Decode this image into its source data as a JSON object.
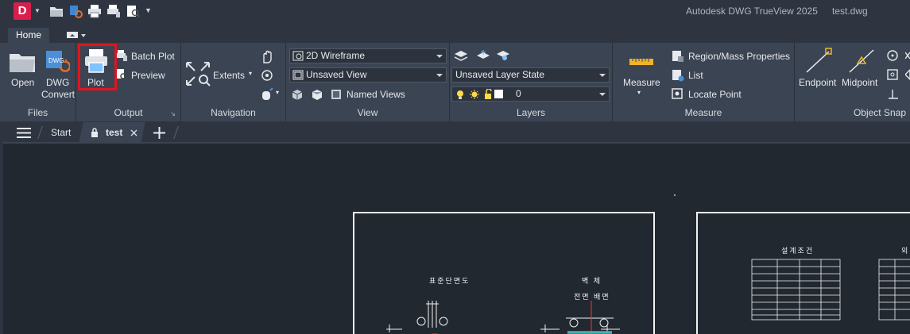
{
  "titlebar": {
    "app_letter": "D",
    "app_title": "Autodesk DWG TrueView 2025",
    "file_name": "test.dwg"
  },
  "tabs": {
    "home": "Home"
  },
  "ribbon": {
    "files": {
      "title": "Files",
      "open": "Open",
      "dwg_convert_line1": "DWG",
      "dwg_convert_line2": "Convert"
    },
    "output": {
      "title": "Output",
      "plot": "Plot",
      "batch_plot": "Batch Plot",
      "preview": "Preview"
    },
    "navigation": {
      "title": "Navigation",
      "extents": "Extents"
    },
    "view": {
      "title": "View",
      "visual_style": "2D Wireframe",
      "saved_view": "Unsaved View",
      "named_views": "Named Views"
    },
    "layers": {
      "title": "Layers",
      "layer_state": "Unsaved Layer State",
      "current_layer": "0"
    },
    "measure": {
      "title": "Measure",
      "measure": "Measure",
      "region_mass": "Region/Mass Properties",
      "list": "List",
      "locate_point": "Locate Point"
    },
    "osnap": {
      "title": "Object Snap",
      "endpoint": "Endpoint",
      "midpoint": "Midpoint"
    }
  },
  "doctabs": {
    "start": "Start",
    "active": "test"
  },
  "drawing": {
    "sheet1_heading": "표준단면도",
    "sheet1_subheading": "벽 체",
    "sheet1_sub2": "전면 배면",
    "sheet2_heading": "설계조건",
    "sheet2_heading_b": "외"
  },
  "colors": {
    "accent_highlight": "#e0141e",
    "app_logo": "#d91e4b",
    "ribbon_bg": "#3b4452",
    "canvas_bg": "#212830"
  }
}
